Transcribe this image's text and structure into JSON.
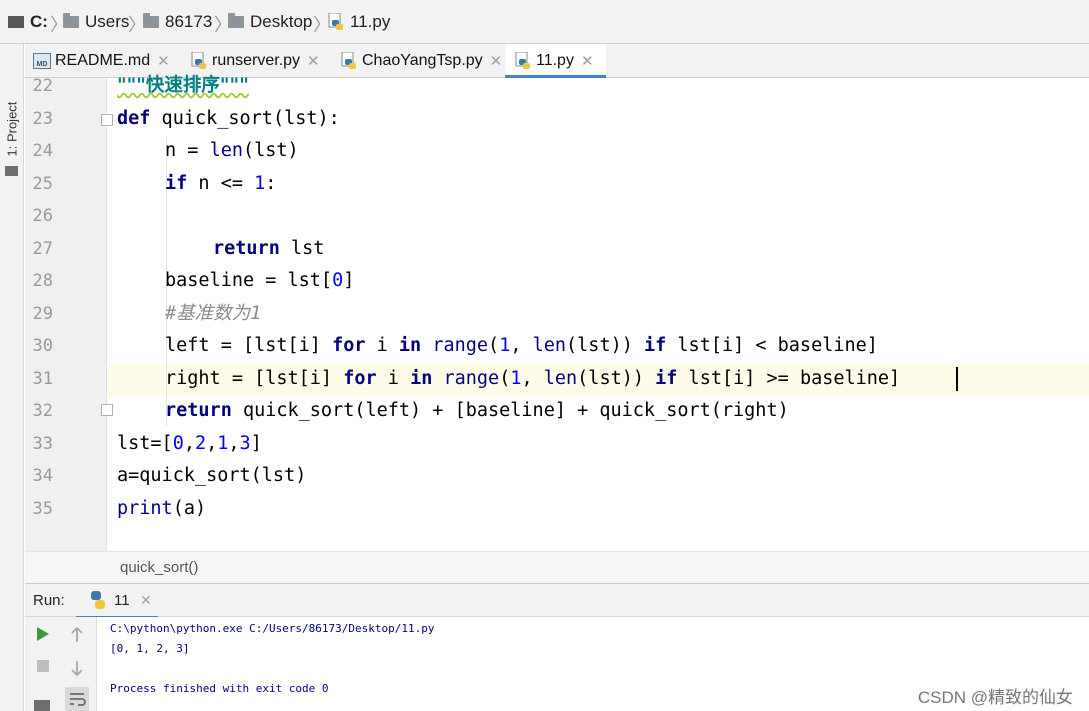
{
  "breadcrumb": {
    "items": [
      "C:",
      "Users",
      "86173",
      "Desktop",
      "11.py"
    ]
  },
  "side_tool": {
    "project_label": "1: Project"
  },
  "tabs": [
    {
      "label": "README.md",
      "active": false
    },
    {
      "label": "runserver.py",
      "active": false
    },
    {
      "label": "ChaoYangTsp.py",
      "active": false
    },
    {
      "label": "11.py",
      "active": true
    }
  ],
  "editor": {
    "line_numbers": [
      "22",
      "23",
      "24",
      "25",
      "26",
      "27",
      "28",
      "29",
      "30",
      "31",
      "32",
      "33",
      "34",
      "35"
    ],
    "current_line": "31",
    "code": {
      "l22_doc": "\"\"\"快速排序\"\"\"",
      "l23_def": "def",
      "l23_rest": " quick_sort(lst):",
      "l24_a": "n = ",
      "l24_len": "len",
      "l24_b": "(lst)",
      "l25_if": "if",
      "l25_a": " n <= ",
      "l25_num": "1",
      "l25_b": ":",
      "l27_return": "return",
      "l27_rest": " lst",
      "l28_a": "baseline = lst[",
      "l28_num": "0",
      "l28_b": "]",
      "l29_comment": "#基准数为1",
      "l30_a": "left = [lst[i] ",
      "l30_for": "for",
      "l30_b": " i ",
      "l30_in": "in",
      "l30_c": " ",
      "l30_range": "range",
      "l30_d": "(",
      "l30_num": "1",
      "l30_e": ", ",
      "l30_len": "len",
      "l30_f": "(lst)) ",
      "l30_if": "if",
      "l30_g": " lst[i] < baseline]",
      "l31_a": "right = [lst[i] ",
      "l31_for": "for",
      "l31_b": " i ",
      "l31_in": "in",
      "l31_c": " ",
      "l31_range": "range",
      "l31_d": "(",
      "l31_num": "1",
      "l31_e": ", ",
      "l31_len": "len",
      "l31_f": "(lst)) ",
      "l31_if": "if",
      "l31_g": " lst[i] >= baseline]",
      "l32_return": "return",
      "l32_rest": " quick_sort(left) + [baseline] + quick_sort(right)",
      "l33_a": "lst=[",
      "l33_n0": "0",
      "l33_c1": ",",
      "l33_n1": "2",
      "l33_c2": ",",
      "l33_n2": "1",
      "l33_c3": ",",
      "l33_n3": "3",
      "l33_b": "]",
      "l34": "a=quick_sort(lst)",
      "l35_print": "print",
      "l35_rest": "(a)"
    }
  },
  "structure_breadcrumb": "quick_sort()",
  "run_panel": {
    "label": "Run:",
    "tab_label": "11",
    "output": [
      "C:\\python\\python.exe C:/Users/86173/Desktop/11.py",
      "[0, 1, 2, 3]",
      "",
      "Process finished with exit code 0"
    ]
  },
  "watermark": "CSDN @精致的仙女",
  "colors": {
    "keyword": "#000080",
    "number": "#0000ff",
    "docstring": "#008080",
    "comment": "#8c8c8c",
    "accent": "#4083c9",
    "current_line": "#fefbe9",
    "console_output": "#000080"
  },
  "icons": [
    "folder-icon",
    "drive-icon",
    "python-file-icon",
    "markdown-file-icon",
    "run-icon",
    "stop-icon",
    "up-arrow-icon",
    "down-arrow-icon",
    "soft-wrap-icon",
    "close-icon",
    "project-icon"
  ]
}
